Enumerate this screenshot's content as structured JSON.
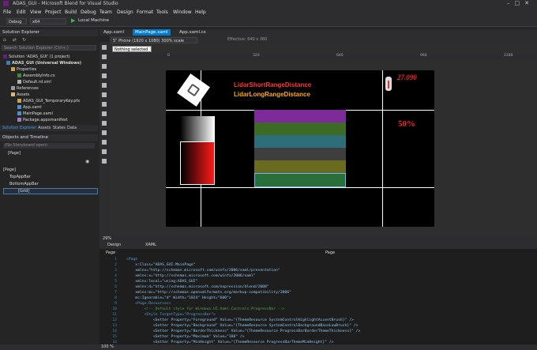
{
  "window": {
    "title": "ADAS_GUI - Microsoft Blend for Visual Studio"
  },
  "menu": [
    "File",
    "Edit",
    "View",
    "Project",
    "Build",
    "Debug",
    "Team",
    "Design",
    "Format",
    "Tools",
    "Window",
    "Help"
  ],
  "toolbar": {
    "config": "Debug",
    "platform": "x64",
    "run_target": "Local Machine"
  },
  "solution_explorer": {
    "title": "Solution Explorer",
    "search_placeholder": "Search Solution Explorer (Ctrl+;)",
    "items": [
      "Solution 'ADAS_GUI' (1 project)",
      "ADAS_GUI (Universal Windows)",
      "Properties",
      "AssemblyInfo.cs",
      "Default.rd.xml",
      "References",
      "Assets",
      "ADAS_GUI_TemporaryKey.pfx",
      "App.xaml",
      "MainPage.xaml",
      "Package.appxmanifest"
    ],
    "tabs": [
      "Solution Explorer",
      "Assets",
      "States",
      "Data"
    ]
  },
  "objects": {
    "title": "Objects and Timeline",
    "storyboard": "(No Storyboard open)",
    "root": "[Page]",
    "tree": [
      "[Page]",
      "TopAppBar",
      "BottomAppBar",
      "[Grid]"
    ]
  },
  "tabs": [
    "App.xaml",
    "MainPage.xaml",
    "App.xaml.cs"
  ],
  "device": {
    "label": "5\" Phone (1920 x 1080) 300% scale",
    "effective": "Effective: 640 x 360"
  },
  "tooltip": "Nothing selected",
  "ruler": [
    "0",
    "320",
    "640",
    "960",
    "1280"
  ],
  "artboard": {
    "label_short": "LidarShortRangeDistance",
    "label_long": "LidarLongRangeDistance",
    "temp_value": "27.090",
    "percent": "50%",
    "colors": {
      "short": "#ff3333",
      "long": "#ffaa00",
      "temp": "#ff2020"
    },
    "bars": [
      "#7f2a9a",
      "#3d6b25",
      "#2d6e78",
      "#3e3e3e",
      "#6b6b20",
      "#2a6e3a"
    ]
  },
  "design": {
    "zoom": "29%",
    "tab_design": "Design",
    "tab_xaml": "XAML"
  },
  "xaml": {
    "left_crumb": "Page",
    "right_crumb": "Page",
    "lines": [
      "<Page",
      "    x:Class=\"ADAS_GUI.MainPage\"",
      "    xmlns=\"http://schemas.microsoft.com/winfx/2006/xaml/presentation\"",
      "    xmlns:x=\"http://schemas.microsoft.com/winfx/2006/xaml\"",
      "    xmlns:local=\"using:ADAS_GUI\"",
      "    xmlns:d=\"http://schemas.microsoft.com/expression/blend/2008\"",
      "    xmlns:mc=\"http://schemas.openxmlformats.org/markup-compatibility/2006\"",
      "    mc:Ignorable=\"d\" Width=\"1024\" Height=\"600\">",
      "    <Page.Resources>",
      "        <!-- Default style for Windows.UI.Xaml.Controls.ProgressBar -->",
      "        <Style TargetType=\"ProgressBar\">",
      "            <Setter Property=\"Foreground\" Value=\"{ThemeResource SystemControlHighlightAccentBrush}\" />",
      "            <Setter Property=\"Background\" Value=\"{ThemeResource SystemControlBackgroundBaseLowBrush}\" />",
      "            <Setter Property=\"BorderThickness\" Value=\"{ThemeResource ProgressBarBorderThemeThickness}\" />",
      "            <Setter Property=\"Maximum\" Value=\"100\" />",
      "            <Setter Property=\"MinHeight\" Value=\"{ThemeResource ProgressBarThemeMinHeight}\" />"
    ],
    "numbers": [
      "1",
      "2",
      "3",
      "4",
      "5",
      "6",
      "7",
      "8",
      "9",
      "10",
      "11",
      "12",
      "13",
      "14",
      "15",
      "16"
    ],
    "zoom": "100 %"
  }
}
